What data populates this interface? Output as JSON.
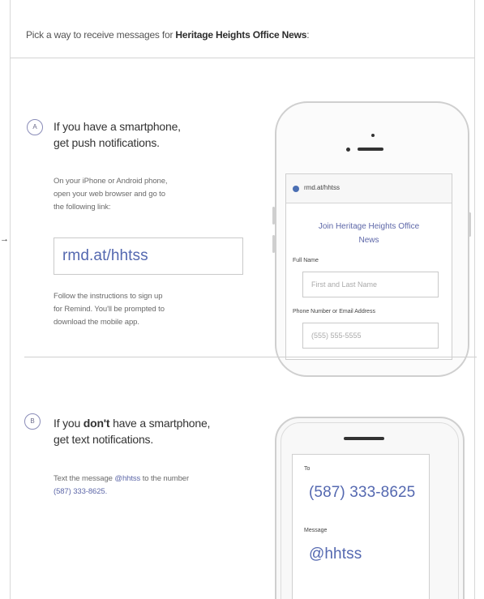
{
  "header": {
    "prefix": "Pick a way to receive messages for ",
    "class_name": "Heritage Heights Office News",
    "suffix": ":"
  },
  "arrow_glyph": "→",
  "option_a": {
    "badge": "A",
    "title_line1": "If you have a smartphone,",
    "title_line2": "get push notifications.",
    "instructions": [
      "On your iPhone or Android phone,",
      "open your web browser and go to",
      "the following link:"
    ],
    "link": "rmd.at/hhtss",
    "follow": [
      "Follow the instructions to sign up",
      "for Remind. You'll be prompted to",
      "download the mobile app."
    ]
  },
  "phone_mockup": {
    "url": "rmd.at/hhtss",
    "join_line1": "Join Heritage Heights Office",
    "join_line2": "News",
    "full_name_label": "Full Name",
    "full_name_placeholder": "First and Last Name",
    "contact_label": "Phone Number or Email Address",
    "contact_placeholder": "(555) 555-5555"
  },
  "option_b": {
    "badge": "B",
    "title_pre": "If you ",
    "title_bold": "don't",
    "title_post": " have a smartphone,",
    "title_line2": "get text notifications.",
    "text_pre": "Text the message ",
    "text_code": "@hhtss",
    "text_mid": " to the number",
    "text_number": "(587) 333-8625."
  },
  "basic_phone": {
    "to_label": "To",
    "to_value": "(587) 333-8625",
    "message_label": "Message",
    "message_value": "@hhtss"
  },
  "colors": {
    "accent": "#5d67a8",
    "link": "#5468b0",
    "border": "#cfcfcf"
  }
}
